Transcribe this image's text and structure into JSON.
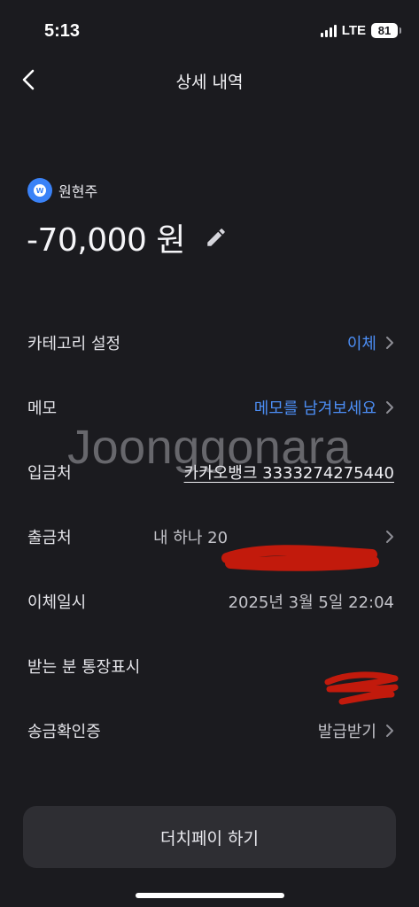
{
  "status_bar": {
    "time": "5:13",
    "network": "LTE",
    "battery": "81"
  },
  "nav": {
    "back_icon": "chevron-left-icon",
    "title": "상세 내역"
  },
  "account": {
    "logo_letter": "W",
    "name": "원현주"
  },
  "amount": {
    "value": "-70,000 원",
    "edit_icon": "pencil-icon"
  },
  "details": {
    "category": {
      "label": "카테고리 설정",
      "value": "이체"
    },
    "memo": {
      "label": "메모",
      "value": "메모를 남겨보세요"
    },
    "deposit_to": {
      "label": "입금처",
      "value": "카카오뱅크 3333274275440"
    },
    "withdraw_from": {
      "label": "출금처",
      "value": "내 하나 20"
    },
    "transfer_date": {
      "label": "이체일시",
      "value": "2025년 3월 5일 22:04"
    },
    "recipient_display": {
      "label": "받는 분 통장표시",
      "value": ""
    },
    "certificate": {
      "label": "송금확인증",
      "value": "발급받기"
    }
  },
  "watermark": "Joonggonara",
  "dutch_pay_button": "더치페이 하기",
  "colors": {
    "background": "#1b1b1f",
    "accent_blue": "#4c8ef5",
    "button_bg": "#2e2e33",
    "redaction_red": "#c21a0c"
  }
}
